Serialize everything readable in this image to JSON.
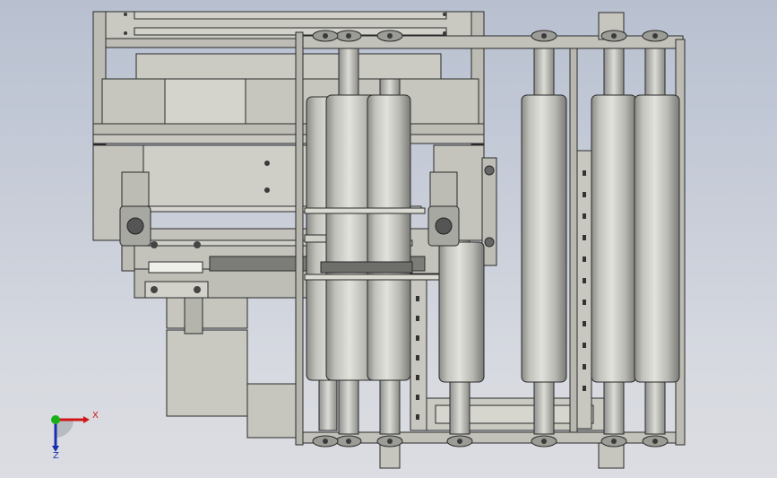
{
  "viewport": {
    "background_top": "#b8c0d0",
    "background_bottom": "#dcdde2"
  },
  "model": {
    "description_icon": "cad-assembly-roller-conveyor",
    "part_color": "#c4c4bc",
    "edge_color": "#2a2a2a",
    "roller_color": "#c8c8c0"
  },
  "triad": {
    "x_label": "X",
    "z_label": "Z",
    "x_color": "#d01818",
    "y_color": "#18b018",
    "z_color": "#1a2fb0"
  }
}
